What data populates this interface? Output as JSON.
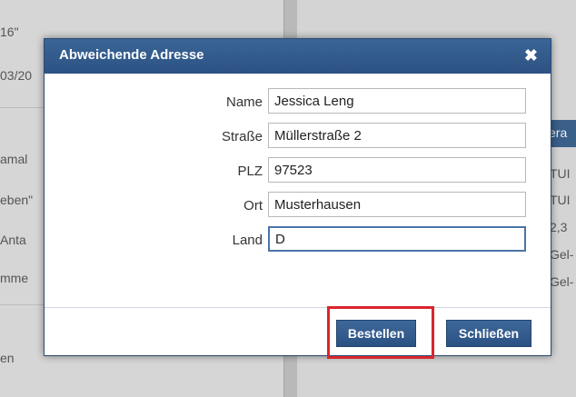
{
  "background": {
    "left_texts": [
      "16\"",
      "03/20",
      "amal",
      "eben\"",
      "Anta",
      "mme",
      "en"
    ],
    "right_texts": [
      "TUI",
      "TUI",
      "2,3",
      "Gel-",
      "Gel-"
    ],
    "right_header_text": "era"
  },
  "dialog": {
    "title": "Abweichende Adresse",
    "close_glyph": "✖",
    "fields": [
      {
        "label": "Name",
        "value": "Jessica Leng"
      },
      {
        "label": "Straße",
        "value": "Müllerstraße 2"
      },
      {
        "label": "PLZ",
        "value": "97523"
      },
      {
        "label": "Ort",
        "value": "Musterhausen"
      },
      {
        "label": "Land",
        "value": "D"
      }
    ],
    "buttons": {
      "order_label": "Bestellen",
      "close_label": "Schließen"
    }
  },
  "colors": {
    "header": "#2c5283",
    "highlight": "#d9262c"
  }
}
